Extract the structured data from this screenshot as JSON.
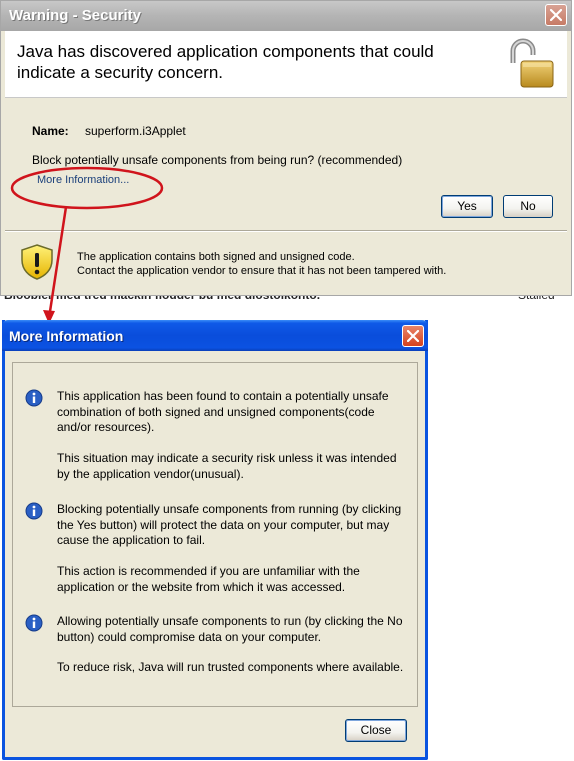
{
  "background": {
    "left_text": "Bloobler med tred mackin flodder bu med dlostolkonto.",
    "right_text": "Stalled"
  },
  "warning_dialog": {
    "title": "Warning - Security",
    "headline": "Java has discovered application components that could indicate a security concern.",
    "name_label": "Name:",
    "name_value": "superform.i3Applet",
    "question": "Block potentially unsafe components from being run? (recommended)",
    "more_info_link": "More Information...",
    "yes_label": "Yes",
    "no_label": "No",
    "footer_line1": "The application contains both signed and unsigned code.",
    "footer_line2": "Contact the application vendor to ensure that it has not been tampered with."
  },
  "more_info_dialog": {
    "title": "More Information",
    "paragraphs": [
      "This application has been found to contain a potentially unsafe combination of both signed and unsigned components(code and/or resources).",
      "This situation may indicate a security risk unless it was intended by the application vendor(unusual).",
      "Blocking potentially unsafe components from running (by clicking the Yes button) will protect the data on your computer, but may cause the application to fail.",
      "This action is recommended if you are unfamiliar with the application or the website from which it was accessed.",
      "Allowing potentially unsafe components to run (by clicking the No button) could compromise data on your computer.",
      "To reduce risk, Java will run trusted components where available."
    ],
    "close_label": "Close"
  },
  "icons": {
    "lock": "padlock-open-icon",
    "shield": "warning-shield-icon",
    "info": "info-icon",
    "close": "close-x-icon"
  },
  "colors": {
    "xp_title_blue": "#0a4ddb",
    "inactive_title_gray": "#b4b4b4",
    "dialog_bg": "#ece9d8",
    "annotation_red": "#d0141c",
    "link_blue": "#1a3f7a"
  }
}
